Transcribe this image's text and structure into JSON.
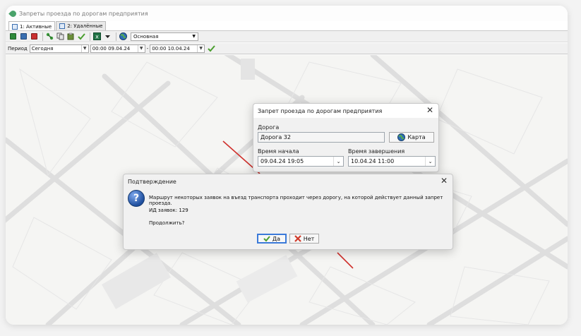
{
  "window": {
    "title": "Запреты проезда по дорогам предприятия"
  },
  "tabs": [
    {
      "label": "1: Активные",
      "active": true
    },
    {
      "label": "2: Удалённые",
      "active": false
    }
  ],
  "toolbar": {
    "icons": [
      "add-icon",
      "edit-icon",
      "delete-icon",
      "route-icon",
      "copy-icon",
      "paste-icon",
      "apply-check-icon",
      "export-excel-icon",
      "dropdown-arrow-icon",
      "globe-icon"
    ],
    "layer_value": "Основная"
  },
  "filter": {
    "period_label": "Период",
    "period_value": "Сегодня",
    "from_value": "00:00 09.04.24",
    "separator": "-",
    "to_value": "00:00 10.04.24"
  },
  "road_dialog": {
    "title": "Запрет проезда по дорогам предприятия",
    "road_label": "Дорога",
    "road_value": "Дорога 32",
    "map_button": "Карта",
    "start_label": "Время начала",
    "start_value": "09.04.24 19:05",
    "end_label": "Время завершения",
    "end_value": "10.04.24 11:00"
  },
  "confirm_dialog": {
    "title": "Подтверждение",
    "message": "Маршрут некоторых заявок на въезд транспорта проходит через дорогу, на которой действует данный запрет проезда.",
    "ids_line": "ИД заявок: 129",
    "question": "Продолжить?",
    "yes_label": "Да",
    "no_label": "Нет"
  },
  "colors": {
    "accent": "#3b7ad9",
    "route": "#d0312d",
    "check": "#4a9e2f",
    "no": "#d03a2a"
  }
}
